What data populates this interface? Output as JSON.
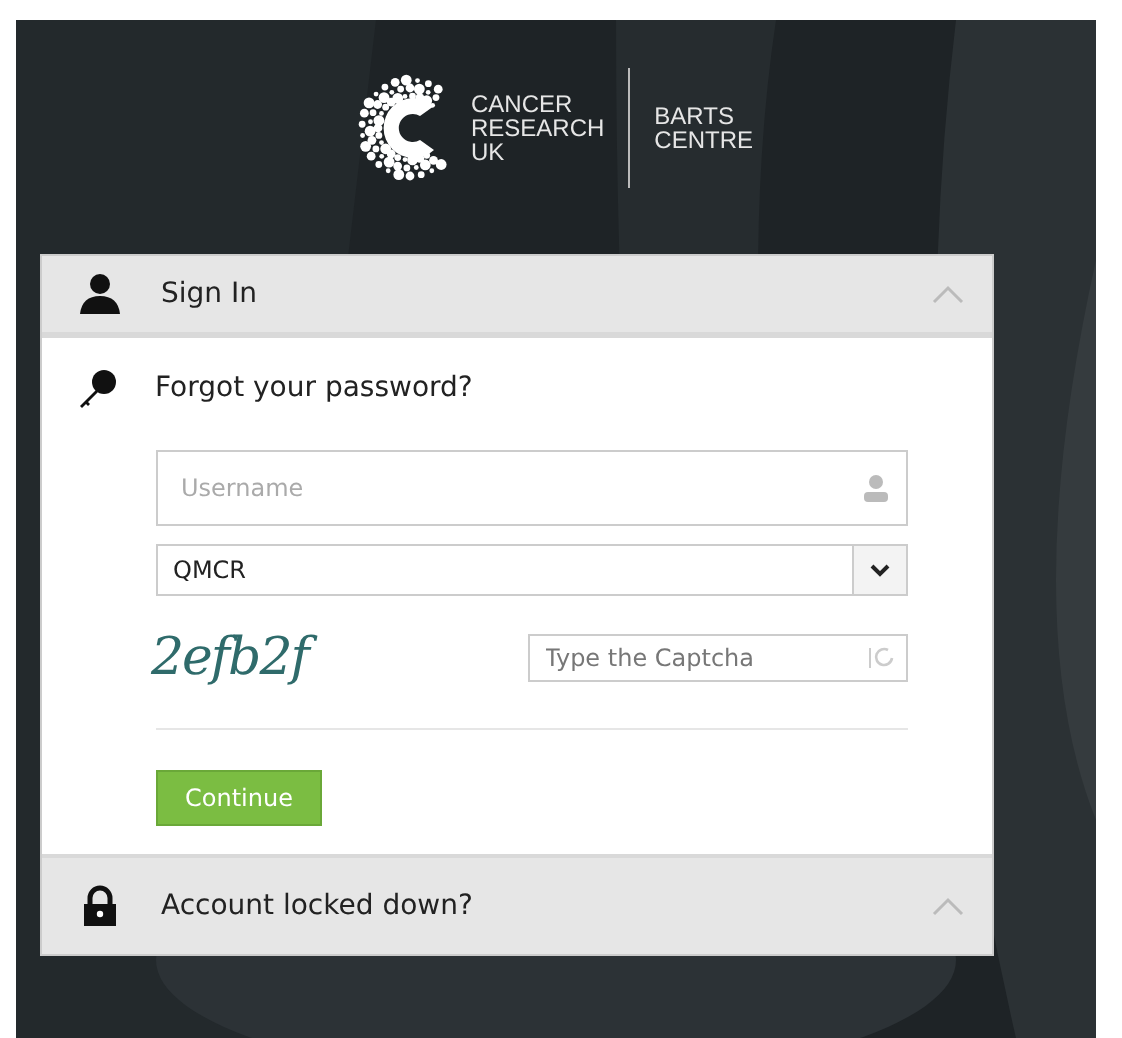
{
  "logo": {
    "org_lines": [
      "CANCER",
      "RESEARCH",
      "UK"
    ],
    "partner_lines": [
      "BARTS",
      "CENTRE"
    ]
  },
  "sign_in": {
    "title": "Sign In",
    "forgot_link": "Forgot your password?",
    "username": {
      "placeholder": "Username"
    },
    "domain_select": {
      "value": "QMCR"
    },
    "captcha": {
      "text": "2efb2f",
      "input_placeholder": "Type the Captcha"
    },
    "continue_button": "Continue"
  },
  "account_locked": {
    "title": "Account locked down?"
  }
}
